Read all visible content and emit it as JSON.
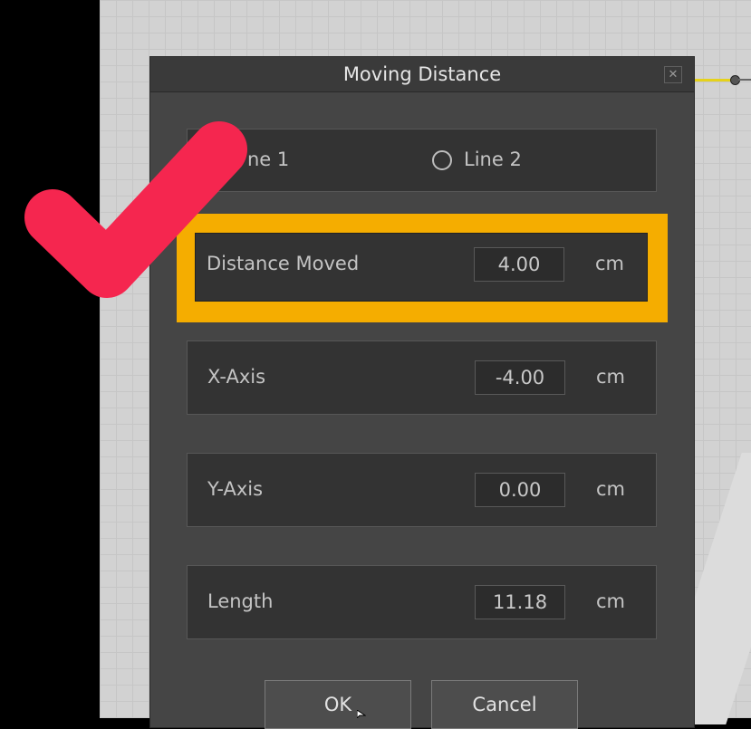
{
  "dialog": {
    "title": "Moving Distance",
    "close_glyph": "✕"
  },
  "line_options": [
    {
      "label": "Line 1",
      "visible_text": "ne 1",
      "selected": true
    },
    {
      "label": "Line 2",
      "selected": false
    }
  ],
  "fields": {
    "distance_moved": {
      "label": "Distance Moved",
      "value": "4.00",
      "unit": "cm"
    },
    "x_axis": {
      "label": "X-Axis",
      "value": "-4.00",
      "unit": "cm"
    },
    "y_axis": {
      "label": "Y-Axis",
      "value": "0.00",
      "unit": "cm"
    },
    "length": {
      "label": "Length",
      "value": "11.18",
      "unit": "cm"
    }
  },
  "buttons": {
    "ok": "OK",
    "cancel": "Cancel"
  },
  "annotation": {
    "checkmark_color": "#f5264f",
    "highlight_color": "#f5ad00",
    "checkmark_icon": "check-icon"
  }
}
